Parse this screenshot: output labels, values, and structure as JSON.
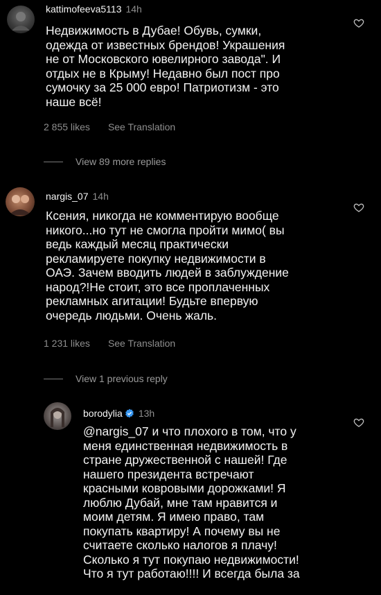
{
  "comments": [
    {
      "username": "kattimofeeva5113",
      "time": "14h",
      "text": "Недвижимость в Дубае! Обувь, сумки,\nодежда от известных брендов! Украшения\nне от Московского ювелирного завода\". И\nотдых не в Крыму! Недавно был пост про\nсумочку за 25 000 евро! Патриотизм - это\nнаше всё!",
      "likes": "2 855 likes",
      "translate": "See Translation",
      "replies": "View 89 more replies",
      "avatar_icon": "user-avatar"
    },
    {
      "username": "nargis_07",
      "time": "14h",
      "text": "Ксения, никогда не комментирую вообще\nникого...но тут не смогла пройти мимо( вы\nведь каждый месяц практически\nрекламируете покупку недвижимости в\nОАЭ. Зачем вводить людей в  заблуждение\nнарод?!Не стоит, это все проплаченных\nрекламных агитации! Будьте впервую\nочередь людьми. Очень жаль.",
      "likes": "1 231 likes",
      "translate": "See Translation",
      "replies": "View 1 previous reply",
      "avatar_icon": "user-avatar"
    },
    {
      "username": "borodylia",
      "time": "13h",
      "verified": true,
      "text": "@nargis_07 и что плохого в том, что у\nменя единственная недвижимость в\nстране дружественной с нашей! Где\nнашего президента встречают\nкрасными ковровыми дорожками!  Я\nлюблю Дубай, мне там нравится и\nмоим детям. Я имею право, там\nпокупать квартиру! А почему вы не\nсчитаете сколько налогов я плачу!\nСколько я тут покупаю недвижимости!\nЧто я тут работаю!!!! И всегда была за",
      "avatar_icon": "user-avatar"
    }
  ],
  "colors": {
    "background": "#000000",
    "muted": "#8e8e8e",
    "verified": "#3897f0"
  }
}
